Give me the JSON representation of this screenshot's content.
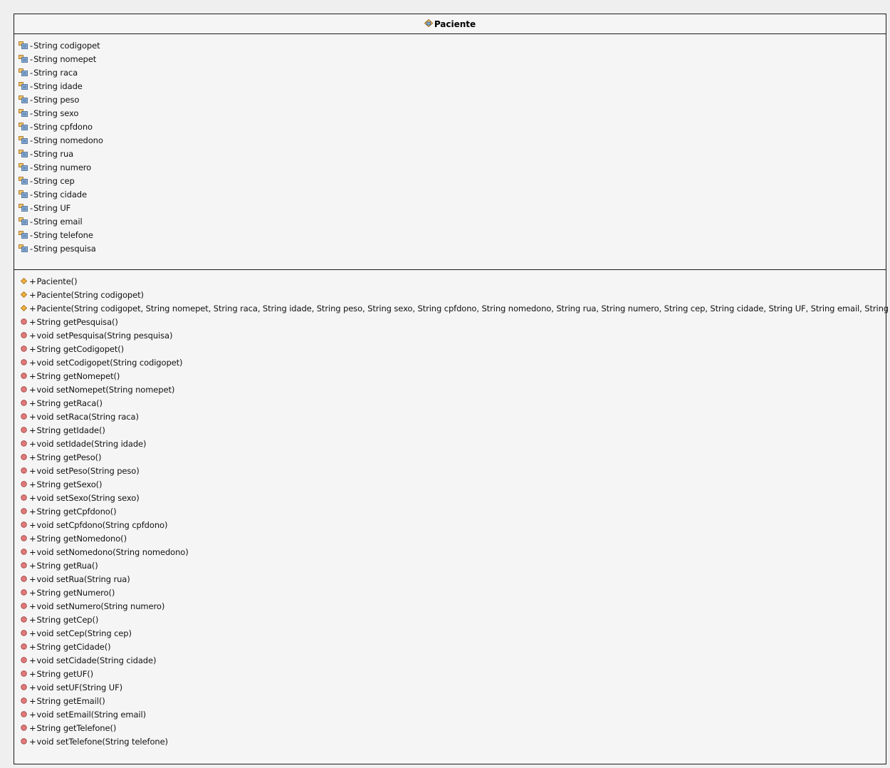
{
  "class_name": "Paciente",
  "attributes": [
    {
      "visibility": "-",
      "text": "String codigopet",
      "icon": "private-field-icon"
    },
    {
      "visibility": "-",
      "text": "String nomepet",
      "icon": "private-field-icon"
    },
    {
      "visibility": "-",
      "text": "String raca",
      "icon": "private-field-icon"
    },
    {
      "visibility": "-",
      "text": "String idade",
      "icon": "private-field-icon"
    },
    {
      "visibility": "-",
      "text": "String peso",
      "icon": "private-field-icon"
    },
    {
      "visibility": "-",
      "text": "String sexo",
      "icon": "private-field-icon"
    },
    {
      "visibility": "-",
      "text": "String cpfdono",
      "icon": "private-field-icon"
    },
    {
      "visibility": "-",
      "text": "String nomedono",
      "icon": "private-field-icon"
    },
    {
      "visibility": "-",
      "text": "String rua",
      "icon": "private-field-icon"
    },
    {
      "visibility": "-",
      "text": "String numero",
      "icon": "private-field-icon"
    },
    {
      "visibility": "-",
      "text": "String cep",
      "icon": "private-field-icon"
    },
    {
      "visibility": "-",
      "text": "String cidade",
      "icon": "private-field-icon"
    },
    {
      "visibility": "-",
      "text": "String UF",
      "icon": "private-field-icon"
    },
    {
      "visibility": "-",
      "text": "String email",
      "icon": "private-field-icon"
    },
    {
      "visibility": "-",
      "text": "String telefone",
      "icon": "private-field-icon"
    },
    {
      "visibility": "-",
      "text": "String pesquisa",
      "icon": "private-field-icon"
    }
  ],
  "methods": [
    {
      "visibility": "+",
      "text": "Paciente()",
      "kind": "constructor"
    },
    {
      "visibility": "+",
      "text": "Paciente(String codigopet)",
      "kind": "constructor"
    },
    {
      "visibility": "+",
      "text": "Paciente(String codigopet, String nomepet, String raca, String idade, String peso, String sexo, String cpfdono, String nomedono, String rua, String numero, String cep, String cidade, String UF, String email, String telefone)",
      "kind": "constructor"
    },
    {
      "visibility": "+",
      "text": "String getPesquisa()",
      "kind": "method"
    },
    {
      "visibility": "+",
      "text": "void setPesquisa(String pesquisa)",
      "kind": "method"
    },
    {
      "visibility": "+",
      "text": "String getCodigopet()",
      "kind": "method"
    },
    {
      "visibility": "+",
      "text": "void setCodigopet(String codigopet)",
      "kind": "method"
    },
    {
      "visibility": "+",
      "text": "String getNomepet()",
      "kind": "method"
    },
    {
      "visibility": "+",
      "text": "void setNomepet(String nomepet)",
      "kind": "method"
    },
    {
      "visibility": "+",
      "text": "String getRaca()",
      "kind": "method"
    },
    {
      "visibility": "+",
      "text": "void setRaca(String raca)",
      "kind": "method"
    },
    {
      "visibility": "+",
      "text": "String getIdade()",
      "kind": "method"
    },
    {
      "visibility": "+",
      "text": "void setIdade(String idade)",
      "kind": "method"
    },
    {
      "visibility": "+",
      "text": "String getPeso()",
      "kind": "method"
    },
    {
      "visibility": "+",
      "text": "void setPeso(String peso)",
      "kind": "method"
    },
    {
      "visibility": "+",
      "text": "String getSexo()",
      "kind": "method"
    },
    {
      "visibility": "+",
      "text": "void setSexo(String sexo)",
      "kind": "method"
    },
    {
      "visibility": "+",
      "text": "String getCpfdono()",
      "kind": "method"
    },
    {
      "visibility": "+",
      "text": "void setCpfdono(String cpfdono)",
      "kind": "method"
    },
    {
      "visibility": "+",
      "text": "String getNomedono()",
      "kind": "method"
    },
    {
      "visibility": "+",
      "text": "void setNomedono(String nomedono)",
      "kind": "method"
    },
    {
      "visibility": "+",
      "text": "String getRua()",
      "kind": "method"
    },
    {
      "visibility": "+",
      "text": "void setRua(String rua)",
      "kind": "method"
    },
    {
      "visibility": "+",
      "text": "String getNumero()",
      "kind": "method"
    },
    {
      "visibility": "+",
      "text": "void setNumero(String numero)",
      "kind": "method"
    },
    {
      "visibility": "+",
      "text": "String getCep()",
      "kind": "method"
    },
    {
      "visibility": "+",
      "text": "void setCep(String cep)",
      "kind": "method"
    },
    {
      "visibility": "+",
      "text": "String getCidade()",
      "kind": "method"
    },
    {
      "visibility": "+",
      "text": "void setCidade(String cidade)",
      "kind": "method"
    },
    {
      "visibility": "+",
      "text": "String getUF()",
      "kind": "method"
    },
    {
      "visibility": "+",
      "text": "void setUF(String UF)",
      "kind": "method"
    },
    {
      "visibility": "+",
      "text": "String getEmail()",
      "kind": "method"
    },
    {
      "visibility": "+",
      "text": "void setEmail(String email)",
      "kind": "method"
    },
    {
      "visibility": "+",
      "text": "String getTelefone()",
      "kind": "method"
    },
    {
      "visibility": "+",
      "text": "void setTelefone(String telefone)",
      "kind": "method"
    }
  ],
  "colors": {
    "background": "#efefef",
    "box_fill": "#f5f5f5",
    "border": "#1a1a1a",
    "constructor_icon": "#f0b040",
    "method_icon": "#e07a7a"
  }
}
